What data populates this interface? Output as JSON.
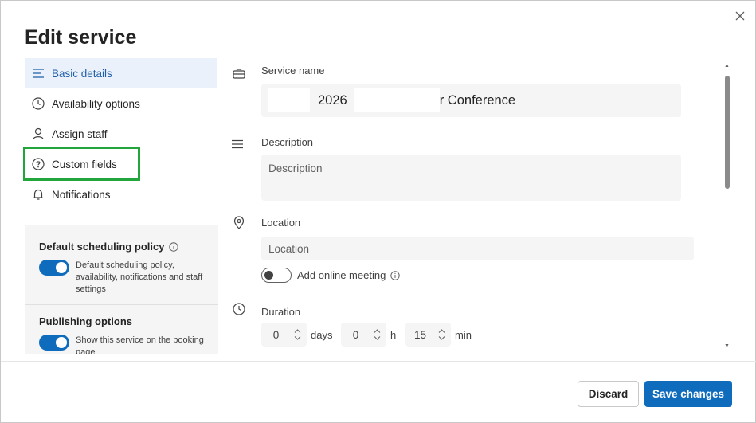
{
  "dialog": {
    "title": "Edit service",
    "close_symbol": "✕"
  },
  "nav": {
    "items": [
      {
        "label": "Basic details",
        "icon": "lines-icon"
      },
      {
        "label": "Availability options",
        "icon": "clock-icon"
      },
      {
        "label": "Assign staff",
        "icon": "person-icon"
      },
      {
        "label": "Custom fields",
        "icon": "question-circle-icon"
      },
      {
        "label": "Notifications",
        "icon": "bell-icon"
      }
    ]
  },
  "policy": {
    "default_title": "Default scheduling policy",
    "default_desc": "Default scheduling policy, availability, notifications and staff settings",
    "publishing_title": "Publishing options",
    "publishing_desc": "Show this service on the booking page"
  },
  "form": {
    "service_name_label": "Service name",
    "service_name_value_a": "2026",
    "service_name_value_b": "r Conference",
    "description_label": "Description",
    "description_placeholder": "Description",
    "location_label": "Location",
    "location_placeholder": "Location",
    "online_meeting_label": "Add online meeting",
    "duration_label": "Duration",
    "days_value": "0",
    "days_unit": "days",
    "hours_value": "0",
    "hours_unit": "h",
    "minutes_value": "15",
    "minutes_unit": "min"
  },
  "footer": {
    "discard_label": "Discard",
    "save_label": "Save changes"
  },
  "colors": {
    "accent": "#0f6cbd",
    "active_nav_bg": "#eaf1fb",
    "highlight_box": "#22a53a"
  }
}
